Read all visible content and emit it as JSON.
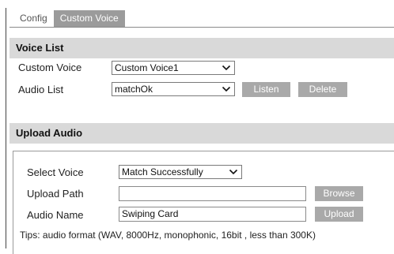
{
  "tabs": [
    {
      "label": "Config",
      "active": false
    },
    {
      "label": "Custom Voice",
      "active": true
    }
  ],
  "voice_list": {
    "title": "Voice List",
    "custom_voice_label": "Custom Voice",
    "custom_voice_value": "Custom Voice1",
    "audio_list_label": "Audio List",
    "audio_list_value": "matchOk",
    "listen_button": "Listen",
    "delete_button": "Delete"
  },
  "upload_audio": {
    "title": "Upload Audio",
    "select_voice_label": "Select Voice",
    "select_voice_value": "Match Successfully",
    "upload_path_label": "Upload Path",
    "upload_path_value": "",
    "browse_button": "Browse",
    "audio_name_label": "Audio Name",
    "audio_name_value": "Swiping Card",
    "upload_button": "Upload",
    "tips": "Tips: audio format (WAV, 8000Hz, monophonic, 16bit , less than 300K)"
  },
  "colors": {
    "section_header_bg": "#d9d9d9",
    "active_tab_bg": "#9b9b9b",
    "button_bg": "#a9a9a9"
  },
  "icons": {
    "dropdown": "chevron-down-icon"
  }
}
